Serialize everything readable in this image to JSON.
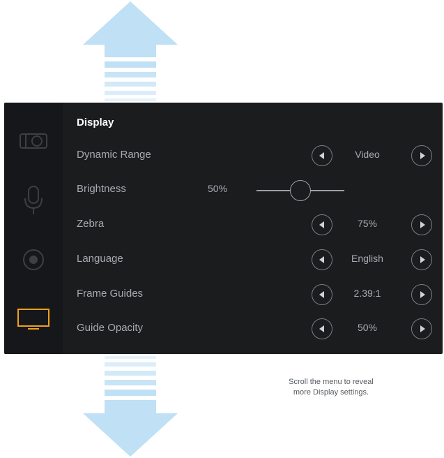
{
  "menu": {
    "title": "Display",
    "rows": [
      {
        "label": "Dynamic Range",
        "value": "Video"
      },
      {
        "label": "Brightness",
        "value": "50%",
        "slider_level": 0.5
      },
      {
        "label": "Zebra",
        "value": "75%"
      },
      {
        "label": "Language",
        "value": "English"
      },
      {
        "label": "Frame Guides",
        "value": "2.39:1"
      },
      {
        "label": "Guide Opacity",
        "value": "50%"
      }
    ]
  },
  "sidebar": {
    "items": [
      {
        "icon": "camera-icon"
      },
      {
        "icon": "microphone-icon"
      },
      {
        "icon": "record-icon"
      },
      {
        "icon": "display-icon",
        "active": true
      }
    ],
    "active_color": "#f0a020"
  },
  "caption": {
    "line1": "Scroll the menu to reveal",
    "line2": "more Display settings."
  },
  "colors": {
    "arrow": "#bfe0f5",
    "panel": "#1a1c1e",
    "accent": "#f0a020"
  }
}
